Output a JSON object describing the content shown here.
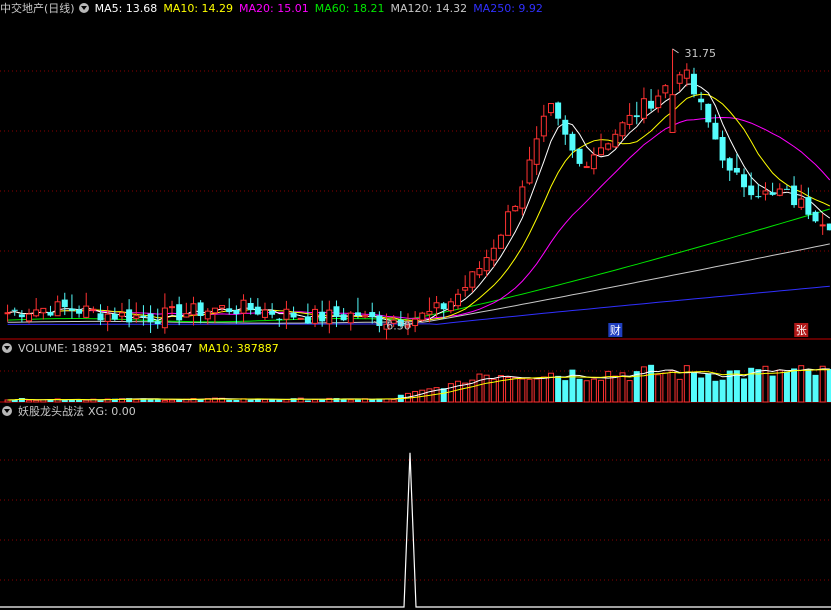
{
  "main_header": {
    "stock_name": "中交地产(日线)",
    "ma5": "MA5: 13.68",
    "ma10": "MA10: 14.29",
    "ma20": "MA20: 15.01",
    "ma60": "MA60: 18.21",
    "ma120": "MA120: 14.32",
    "ma250": "MA250: 9.92"
  },
  "volume_header": {
    "volume": "VOLUME: 188921",
    "ma5": "MA5: 386047",
    "ma10": "MA10: 387887"
  },
  "indicator_header": {
    "name": "妖股龙头战法",
    "xg": "XG: 0.00"
  },
  "colors": {
    "up": "#ff3232",
    "down": "#54fcfc",
    "ma5": "#ffffff",
    "ma10": "#ffff00",
    "ma20": "#ff00ff",
    "ma60": "#00e600",
    "ma120": "#c8c8c8",
    "ma250": "#3030ff",
    "grid": "#8c0000"
  },
  "chart_data": [
    {
      "type": "candlestick",
      "annotations": {
        "high": {
          "label": "31.75",
          "value": 31.75
        },
        "low": {
          "label": "6.30",
          "value": 6.3
        }
      },
      "event_markers": [
        "财",
        "张"
      ],
      "ylim": [
        5.5,
        33.5
      ]
    },
    {
      "type": "bar",
      "name": "VOLUME"
    },
    {
      "type": "line",
      "name": "XG",
      "peak": 1,
      "ylim": [
        0,
        1.2
      ]
    }
  ]
}
